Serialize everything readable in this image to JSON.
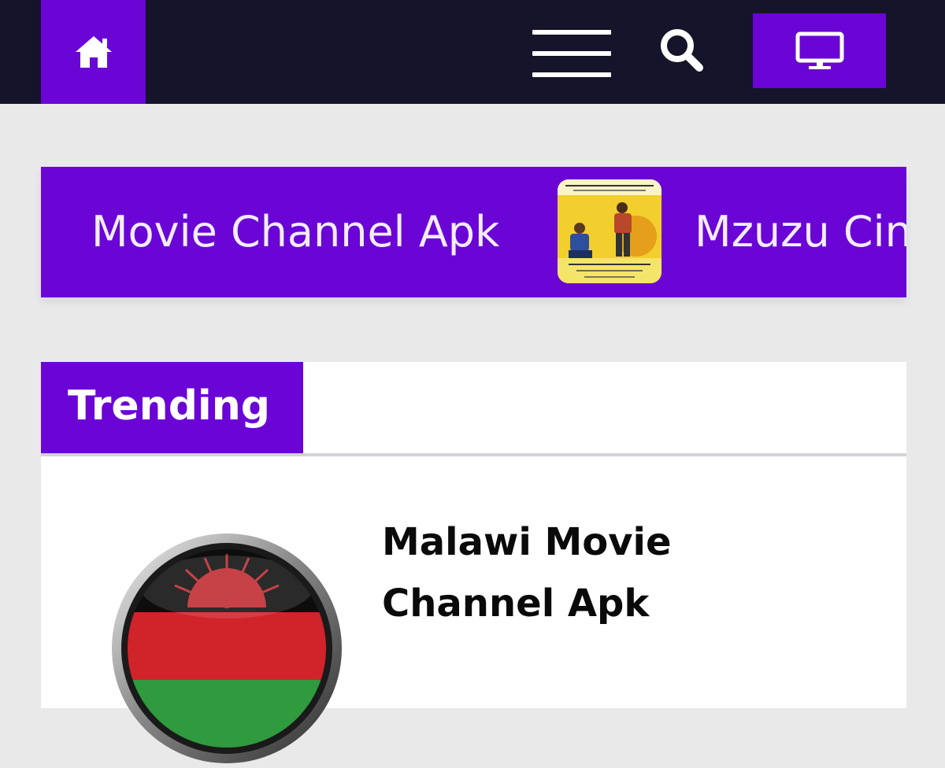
{
  "header": {
    "home_icon": "home-icon",
    "menu_icon": "hamburger-menu-icon",
    "search_icon": "search-icon",
    "tv_icon": "monitor-icon"
  },
  "ticker": {
    "items": [
      {
        "label": "Movie Channel Apk"
      },
      {
        "label": "Mzuzu Cine"
      }
    ]
  },
  "trending": {
    "heading": "Trending",
    "posts": [
      {
        "title": "Malawi Movie Channel Apk",
        "thumb_icon": "malawi-flag-icon"
      }
    ]
  },
  "colors": {
    "accent": "#6a05d6",
    "topbar": "#15142a",
    "background": "#e9e9ea"
  }
}
